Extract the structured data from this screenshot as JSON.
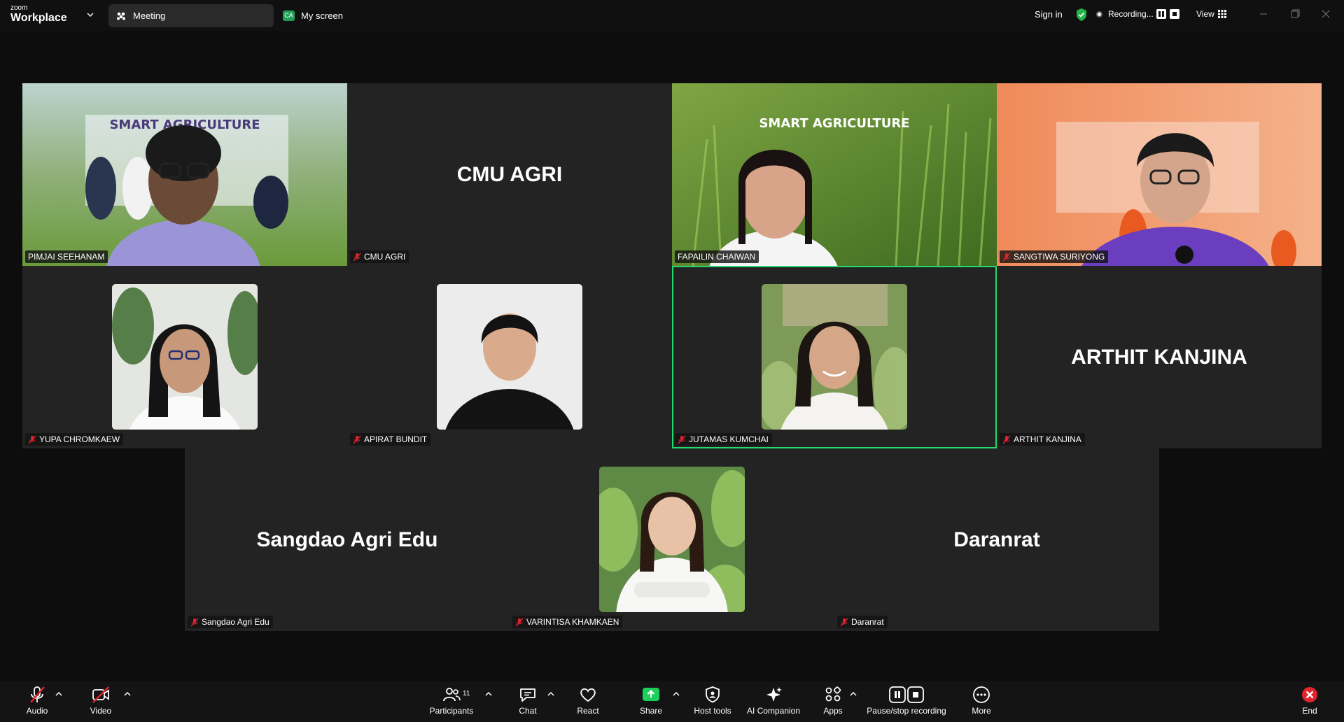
{
  "app": {
    "brand_small": "zoom",
    "brand_large": "Workplace"
  },
  "tabs": {
    "meeting": "Meeting",
    "screen_badge": "CA",
    "screen": "My screen"
  },
  "header": {
    "sign_in": "Sign in",
    "recording": "Recording...",
    "view": "View"
  },
  "participants_tiles": [
    {
      "name": "PIMJAI SEEHANAM",
      "muted": false,
      "video": true,
      "display": ""
    },
    {
      "name": "CMU AGRI",
      "muted": true,
      "video": false,
      "display": "CMU AGRI"
    },
    {
      "name": "FAPAILIN CHAIWAN",
      "muted": false,
      "video": true,
      "display": ""
    },
    {
      "name": "SANGTIWA SURIYONG",
      "muted": true,
      "video": true,
      "display": ""
    },
    {
      "name": "YUPA CHROMKAEW",
      "muted": true,
      "video": false,
      "display": ""
    },
    {
      "name": "APIRAT BUNDIT",
      "muted": true,
      "video": false,
      "display": ""
    },
    {
      "name": "JUTAMAS KUMCHAI",
      "muted": true,
      "video": false,
      "display": "",
      "active": true
    },
    {
      "name": "ARTHIT KANJINA",
      "muted": true,
      "video": false,
      "display": "ARTHIT KANJINA"
    },
    {
      "name": "Sangdao Agri Edu",
      "muted": true,
      "video": false,
      "display": "Sangdao Agri Edu"
    },
    {
      "name": "VARINTISA KHAMKAEN",
      "muted": true,
      "video": false,
      "display": ""
    },
    {
      "name": "Daranrat",
      "muted": true,
      "video": false,
      "display": "Daranrat"
    }
  ],
  "toolbar": {
    "audio": "Audio",
    "video": "Video",
    "participants": "Participants",
    "participants_count": "11",
    "chat": "Chat",
    "react": "React",
    "share": "Share",
    "host_tools": "Host tools",
    "ai_companion": "AI Companion",
    "apps": "Apps",
    "pause_stop_recording": "Pause/stop recording",
    "more": "More",
    "end": "End"
  },
  "colors": {
    "active_speaker": "#23d96e",
    "share_green": "#1fcf5c",
    "end_red": "#e0242e",
    "mute_red": "#e0242e"
  }
}
